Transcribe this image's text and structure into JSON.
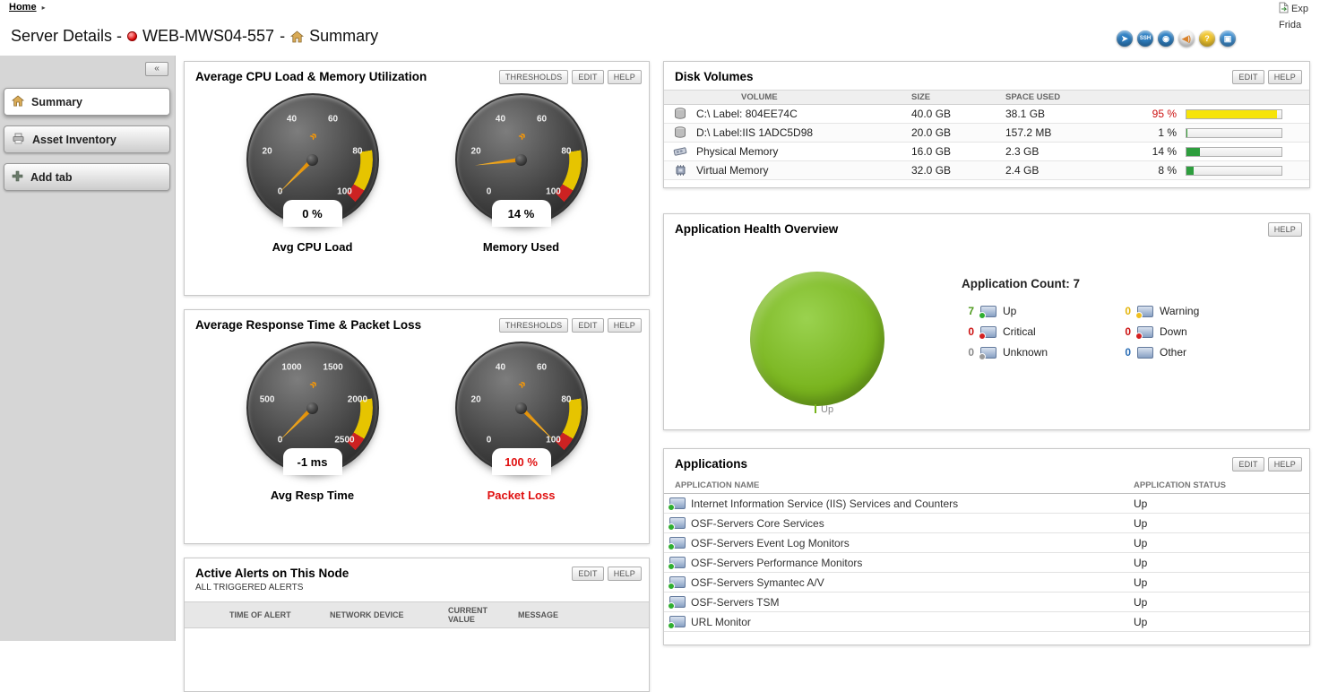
{
  "page": {
    "breadcrumb": {
      "home": "Home",
      "arrow": "▸"
    },
    "top_right": {
      "export": "Exp",
      "date": "Frida"
    },
    "title": {
      "prefix": "Server Details -",
      "node": "WEB-MWS04-557",
      "sep": "-",
      "view": "Summary"
    }
  },
  "toolbar": {
    "icons": [
      {
        "name": "telnet",
        "glyph": "➤",
        "bg": "#2f80c3",
        "fg": "#ffffff"
      },
      {
        "name": "ssh",
        "glyph": "SSH",
        "bg": "#2f80c3",
        "fg": "#ffffff"
      },
      {
        "name": "ping",
        "glyph": "◉",
        "bg": "#2f80c3",
        "fg": "#ffffff"
      },
      {
        "name": "mute-alerts",
        "glyph": "◀)",
        "bg": "#f2f2f2",
        "fg": "#d9822b"
      },
      {
        "name": "help",
        "glyph": "?",
        "bg": "#f0c52e",
        "fg": "#ffffff"
      },
      {
        "name": "remote-desktop",
        "glyph": "▣",
        "bg": "#3f8fd0",
        "fg": "#ffffff"
      }
    ]
  },
  "sidebar": {
    "collapse": "«",
    "tabs": [
      {
        "label": "Summary"
      },
      {
        "label": "Asset Inventory"
      },
      {
        "label": "Add tab"
      }
    ]
  },
  "panels": {
    "cpu_mem": {
      "title": "Average CPU Load & Memory Utilization",
      "buttons": [
        "THRESHOLDS",
        "EDIT",
        "HELP"
      ],
      "gauges": [
        {
          "label": "Avg CPU Load",
          "value": 0,
          "min": 0,
          "max": 100,
          "value_label": "0 %",
          "ticks": [
            "0",
            "20",
            "40",
            "60",
            "80",
            "100"
          ]
        },
        {
          "label": "Memory Used",
          "value": 14,
          "min": 0,
          "max": 100,
          "value_label": "14 %",
          "ticks": [
            "0",
            "20",
            "40",
            "60",
            "80",
            "100"
          ]
        }
      ]
    },
    "resp_loss": {
      "title": "Average Response Time & Packet Loss",
      "buttons": [
        "THRESHOLDS",
        "EDIT",
        "HELP"
      ],
      "gauges": [
        {
          "label": "Avg Resp Time",
          "value": -1,
          "min": 0,
          "max": 2500,
          "value_label": "-1 ms",
          "ticks": [
            "0",
            "500",
            "1000",
            "1500",
            "2000",
            "2500"
          ]
        },
        {
          "label": "Packet Loss",
          "value": 100,
          "min": 0,
          "max": 100,
          "value_label": "100 %",
          "ticks": [
            "0",
            "20",
            "40",
            "60",
            "80",
            "100"
          ],
          "value_color": "#e01010",
          "label_color": "#e01010"
        }
      ]
    },
    "alerts": {
      "title": "Active Alerts on This Node",
      "subtitle": "ALL TRIGGERED ALERTS",
      "buttons": [
        "EDIT",
        "HELP"
      ],
      "columns": [
        "TIME OF ALERT",
        "NETWORK DEVICE",
        "CURRENT VALUE",
        "MESSAGE"
      ]
    },
    "disk": {
      "title": "Disk Volumes",
      "buttons": [
        "EDIT",
        "HELP"
      ],
      "columns": [
        "VOLUME",
        "SIZE",
        "SPACE USED"
      ],
      "rows": [
        {
          "volume": "C:\\ Label: 804EE74C",
          "size": "40.0 GB",
          "used": "38.1 GB",
          "pct": "95 %",
          "pct_value": 95,
          "pct_color": "#cc1111",
          "bar_color": "#f6e40a"
        },
        {
          "volume": "D:\\ Label:IIS 1ADC5D98",
          "size": "20.0 GB",
          "used": "157.2 MB",
          "pct": "1 %",
          "pct_value": 1,
          "pct_color": "#222222",
          "bar_color": "#3aa63a"
        },
        {
          "volume": "Physical Memory",
          "size": "16.0 GB",
          "used": "2.3 GB",
          "pct": "14 %",
          "pct_value": 14,
          "pct_color": "#222222",
          "bar_color": "#2e9e3e"
        },
        {
          "volume": "Virtual Memory",
          "size": "32.0 GB",
          "used": "2.4 GB",
          "pct": "8 %",
          "pct_value": 8,
          "pct_color": "#222222",
          "bar_color": "#2e9e3e"
        }
      ]
    },
    "health": {
      "title": "Application Health Overview",
      "buttons": [
        "HELP"
      ],
      "count_label": "Application Count: 7",
      "pie_label": "Up",
      "pie_color": "#79b41e",
      "legend": [
        {
          "count": "7",
          "label": "Up",
          "count_color": "#4e9a1d",
          "dot_color": "#2fae2f"
        },
        {
          "count": "0",
          "label": "Warning",
          "count_color": "#e3b50c",
          "dot_color": "#f0c020"
        },
        {
          "count": "0",
          "label": "Critical",
          "count_color": "#cc1111",
          "dot_color": "#d42020"
        },
        {
          "count": "0",
          "label": "Down",
          "count_color": "#cc1111",
          "dot_color": "#d42020"
        },
        {
          "count": "0",
          "label": "Unknown",
          "count_color": "#8a8a8a",
          "dot_color": "#9a9a9a"
        },
        {
          "count": "0",
          "label": "Other",
          "count_color": "#2a6db5"
        }
      ]
    },
    "apps": {
      "title": "Applications",
      "buttons": [
        "EDIT",
        "HELP"
      ],
      "columns": [
        "APPLICATION NAME",
        "APPLICATION STATUS"
      ],
      "rows": [
        {
          "name": "Internet Information Service (IIS) Services and Counters",
          "status": "Up"
        },
        {
          "name": "OSF-Servers Core Services",
          "status": "Up"
        },
        {
          "name": "OSF-Servers Event Log Monitors",
          "status": "Up"
        },
        {
          "name": "OSF-Servers Performance Monitors",
          "status": "Up"
        },
        {
          "name": "OSF-Servers Symantec A/V",
          "status": "Up"
        },
        {
          "name": "OSF-Servers TSM",
          "status": "Up"
        },
        {
          "name": "URL Monitor",
          "status": "Up"
        }
      ]
    }
  }
}
